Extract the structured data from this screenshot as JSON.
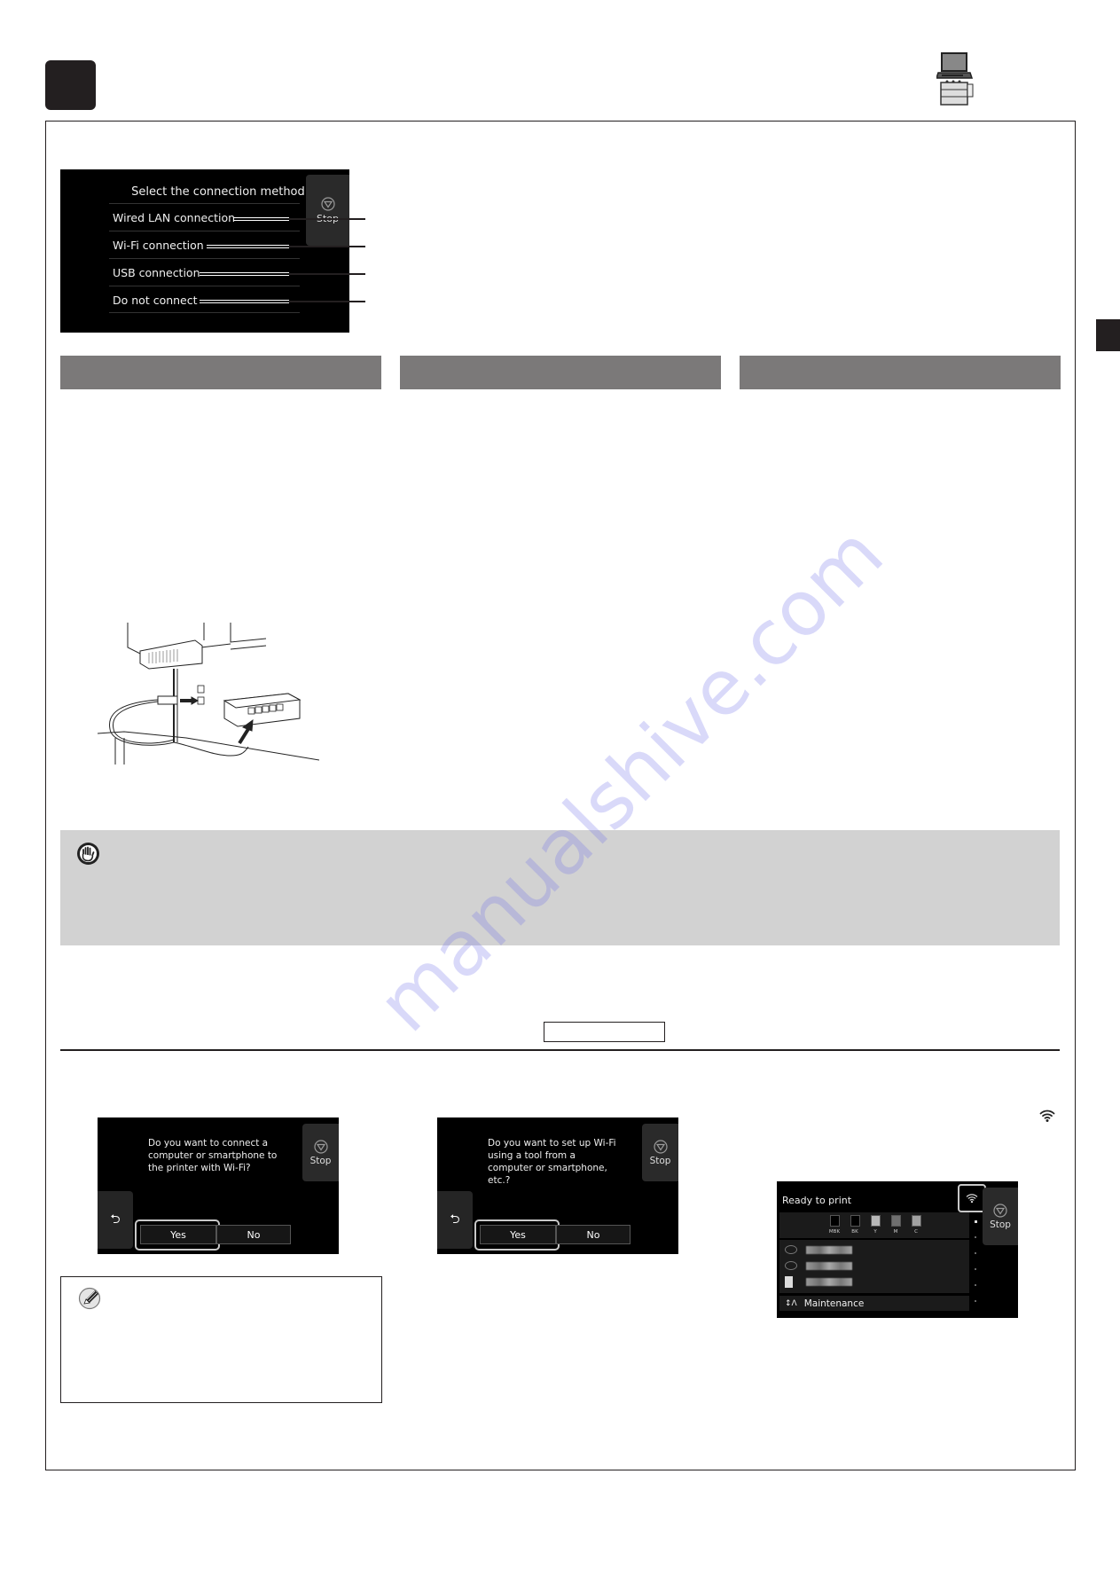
{
  "step_badge": {
    "label": ""
  },
  "device_icon": {
    "name": "computer-and-printer-icon"
  },
  "connection_screen": {
    "title": "Select the connection method.",
    "stop_label": "Stop",
    "options": [
      {
        "label": "Wired LAN connection"
      },
      {
        "label": "Wi-Fi connection"
      },
      {
        "label": "USB connection"
      },
      {
        "label": "Do not connect"
      }
    ]
  },
  "section_headers": [
    {
      "label": ""
    },
    {
      "label": ""
    },
    {
      "label": ""
    }
  ],
  "important_box": {
    "icon": "hand-stop-icon",
    "text": ""
  },
  "reference_box": {
    "label": ""
  },
  "wifi_connect_screen": {
    "question": "Do you want to connect a computer or smartphone to the printer with Wi-Fi?",
    "stop_label": "Stop",
    "back_icon": "⮌",
    "yes_label": "Yes",
    "no_label": "No"
  },
  "wifi_tool_screen": {
    "question": "Do you want to set up Wi-Fi using a tool from a computer or smartphone, etc.?",
    "stop_label": "Stop",
    "back_icon": "⮌",
    "yes_label": "Yes",
    "no_label": "No"
  },
  "note_box": {
    "icon": "pencil-note-icon",
    "text": ""
  },
  "home_screen": {
    "status": "Ready to print",
    "stop_label": "Stop",
    "inks": [
      {
        "label": "MBK",
        "color": "#000000"
      },
      {
        "label": "BK",
        "color": "#000000"
      },
      {
        "label": "Y",
        "color": "#b8b8b8"
      },
      {
        "label": "M",
        "color": "#6f6f6f"
      },
      {
        "label": "C",
        "color": "#a0a0a0"
      }
    ],
    "maintenance_label": "Maintenance"
  },
  "watermark": {
    "text": "manualshive.com"
  },
  "colors": {
    "section_header": "#7b7979",
    "important_bg": "#d2d2d2",
    "badge": "#231f20"
  }
}
